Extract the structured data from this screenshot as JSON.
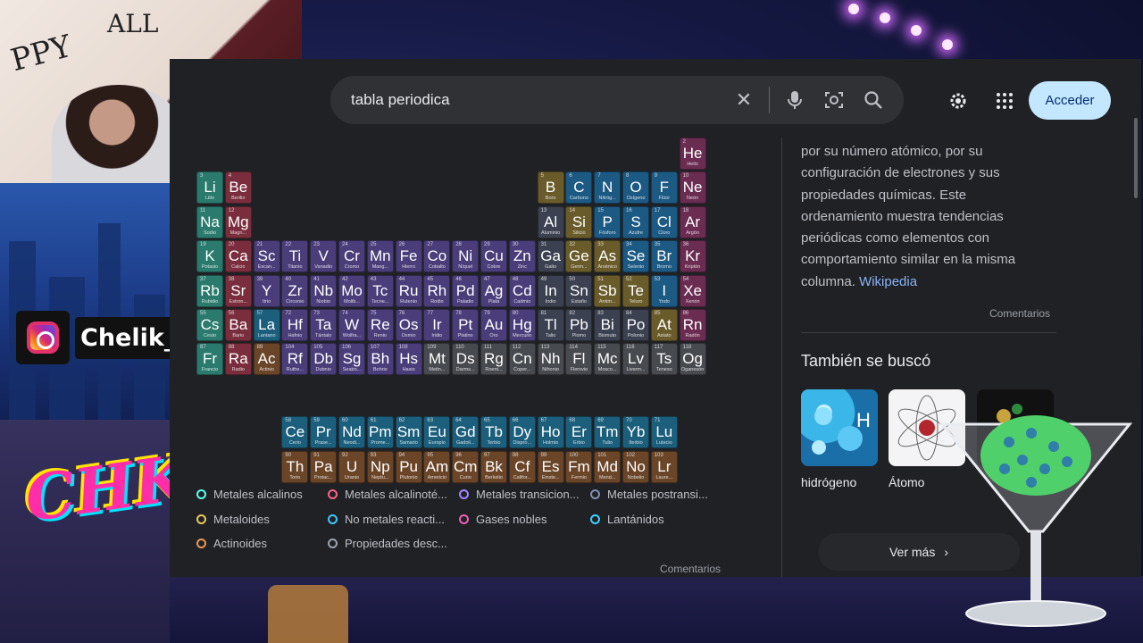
{
  "search": {
    "query": "tabla periodica"
  },
  "header": {
    "login_label": "Acceder"
  },
  "stream": {
    "instagram_handle": "Chelik_Sama",
    "logo_text": "CHK"
  },
  "colors": {
    "alkali": "#2a7a6d",
    "alkaline_earth": "#7a2d3c",
    "transition": "#4a3d7a",
    "post_transition": "#3c4151",
    "metalloid": "#6a5c2a",
    "nonmetal": "#1c5a84",
    "noble_gas": "#6b2c52",
    "lanthanide": "#1b5f7d",
    "actinide": "#6b4528",
    "unknown": "#474a4f"
  },
  "periodic_table": {
    "elements": [
      {
        "n": "2",
        "s": "He",
        "name": "Helio",
        "c": "noble_gas",
        "r": 0,
        "col": 17
      },
      {
        "n": "3",
        "s": "Li",
        "name": "Litio",
        "c": "alkali",
        "r": 1,
        "col": 0
      },
      {
        "n": "4",
        "s": "Be",
        "name": "Berilio",
        "c": "alkaline_earth",
        "r": 1,
        "col": 1
      },
      {
        "n": "5",
        "s": "B",
        "name": "Boro",
        "c": "metalloid",
        "r": 1,
        "col": 12
      },
      {
        "n": "6",
        "s": "C",
        "name": "Carbono",
        "c": "nonmetal",
        "r": 1,
        "col": 13
      },
      {
        "n": "7",
        "s": "N",
        "name": "Nitróg...",
        "c": "nonmetal",
        "r": 1,
        "col": 14
      },
      {
        "n": "8",
        "s": "O",
        "name": "Oxígeno",
        "c": "nonmetal",
        "r": 1,
        "col": 15
      },
      {
        "n": "9",
        "s": "F",
        "name": "Flúor",
        "c": "nonmetal",
        "r": 1,
        "col": 16
      },
      {
        "n": "10",
        "s": "Ne",
        "name": "Neón",
        "c": "noble_gas",
        "r": 1,
        "col": 17
      },
      {
        "n": "11",
        "s": "Na",
        "name": "Sodio",
        "c": "alkali",
        "r": 2,
        "col": 0
      },
      {
        "n": "12",
        "s": "Mg",
        "name": "Magn...",
        "c": "alkaline_earth",
        "r": 2,
        "col": 1
      },
      {
        "n": "13",
        "s": "Al",
        "name": "Aluminio",
        "c": "post_transition",
        "r": 2,
        "col": 12
      },
      {
        "n": "14",
        "s": "Si",
        "name": "Silicio",
        "c": "metalloid",
        "r": 2,
        "col": 13
      },
      {
        "n": "15",
        "s": "P",
        "name": "Fósforo",
        "c": "nonmetal",
        "r": 2,
        "col": 14
      },
      {
        "n": "16",
        "s": "S",
        "name": "Azufre",
        "c": "nonmetal",
        "r": 2,
        "col": 15
      },
      {
        "n": "17",
        "s": "Cl",
        "name": "Cloro",
        "c": "nonmetal",
        "r": 2,
        "col": 16
      },
      {
        "n": "18",
        "s": "Ar",
        "name": "Argón",
        "c": "noble_gas",
        "r": 2,
        "col": 17
      },
      {
        "n": "19",
        "s": "K",
        "name": "Potasio",
        "c": "alkali",
        "r": 3,
        "col": 0
      },
      {
        "n": "20",
        "s": "Ca",
        "name": "Calcio",
        "c": "alkaline_earth",
        "r": 3,
        "col": 1
      },
      {
        "n": "21",
        "s": "Sc",
        "name": "Escan...",
        "c": "transition",
        "r": 3,
        "col": 2
      },
      {
        "n": "22",
        "s": "Ti",
        "name": "Titanio",
        "c": "transition",
        "r": 3,
        "col": 3
      },
      {
        "n": "23",
        "s": "V",
        "name": "Vanadio",
        "c": "transition",
        "r": 3,
        "col": 4
      },
      {
        "n": "24",
        "s": "Cr",
        "name": "Cromo",
        "c": "transition",
        "r": 3,
        "col": 5
      },
      {
        "n": "25",
        "s": "Mn",
        "name": "Mang...",
        "c": "transition",
        "r": 3,
        "col": 6
      },
      {
        "n": "26",
        "s": "Fe",
        "name": "Hierro",
        "c": "transition",
        "r": 3,
        "col": 7
      },
      {
        "n": "27",
        "s": "Co",
        "name": "Cobalto",
        "c": "transition",
        "r": 3,
        "col": 8
      },
      {
        "n": "28",
        "s": "Ni",
        "name": "Níquel",
        "c": "transition",
        "r": 3,
        "col": 9
      },
      {
        "n": "29",
        "s": "Cu",
        "name": "Cobre",
        "c": "transition",
        "r": 3,
        "col": 10
      },
      {
        "n": "30",
        "s": "Zn",
        "name": "Zinc",
        "c": "transition",
        "r": 3,
        "col": 11
      },
      {
        "n": "31",
        "s": "Ga",
        "name": "Galio",
        "c": "post_transition",
        "r": 3,
        "col": 12
      },
      {
        "n": "32",
        "s": "Ge",
        "name": "Germ...",
        "c": "metalloid",
        "r": 3,
        "col": 13
      },
      {
        "n": "33",
        "s": "As",
        "name": "Arsénico",
        "c": "metalloid",
        "r": 3,
        "col": 14
      },
      {
        "n": "34",
        "s": "Se",
        "name": "Selenio",
        "c": "nonmetal",
        "r": 3,
        "col": 15
      },
      {
        "n": "35",
        "s": "Br",
        "name": "Bromo",
        "c": "nonmetal",
        "r": 3,
        "col": 16
      },
      {
        "n": "36",
        "s": "Kr",
        "name": "Kriptón",
        "c": "noble_gas",
        "r": 3,
        "col": 17
      },
      {
        "n": "37",
        "s": "Rb",
        "name": "Rubidio",
        "c": "alkali",
        "r": 4,
        "col": 0
      },
      {
        "n": "38",
        "s": "Sr",
        "name": "Estron...",
        "c": "alkaline_earth",
        "r": 4,
        "col": 1
      },
      {
        "n": "39",
        "s": "Y",
        "name": "Itrio",
        "c": "transition",
        "r": 4,
        "col": 2
      },
      {
        "n": "40",
        "s": "Zr",
        "name": "Circonio",
        "c": "transition",
        "r": 4,
        "col": 3
      },
      {
        "n": "41",
        "s": "Nb",
        "name": "Niobio",
        "c": "transition",
        "r": 4,
        "col": 4
      },
      {
        "n": "42",
        "s": "Mo",
        "name": "Molib...",
        "c": "transition",
        "r": 4,
        "col": 5
      },
      {
        "n": "43",
        "s": "Tc",
        "name": "Tecne...",
        "c": "transition",
        "r": 4,
        "col": 6
      },
      {
        "n": "44",
        "s": "Ru",
        "name": "Rutenio",
        "c": "transition",
        "r": 4,
        "col": 7
      },
      {
        "n": "45",
        "s": "Rh",
        "name": "Rodio",
        "c": "transition",
        "r": 4,
        "col": 8
      },
      {
        "n": "46",
        "s": "Pd",
        "name": "Paladio",
        "c": "transition",
        "r": 4,
        "col": 9
      },
      {
        "n": "47",
        "s": "Ag",
        "name": "Plata",
        "c": "transition",
        "r": 4,
        "col": 10
      },
      {
        "n": "48",
        "s": "Cd",
        "name": "Cadmio",
        "c": "transition",
        "r": 4,
        "col": 11
      },
      {
        "n": "49",
        "s": "In",
        "name": "Indio",
        "c": "post_transition",
        "r": 4,
        "col": 12
      },
      {
        "n": "50",
        "s": "Sn",
        "name": "Estaño",
        "c": "post_transition",
        "r": 4,
        "col": 13
      },
      {
        "n": "51",
        "s": "Sb",
        "name": "Antim...",
        "c": "metalloid",
        "r": 4,
        "col": 14
      },
      {
        "n": "52",
        "s": "Te",
        "name": "Teluro",
        "c": "metalloid",
        "r": 4,
        "col": 15
      },
      {
        "n": "53",
        "s": "I",
        "name": "Yodo",
        "c": "nonmetal",
        "r": 4,
        "col": 16
      },
      {
        "n": "54",
        "s": "Xe",
        "name": "Xenón",
        "c": "noble_gas",
        "r": 4,
        "col": 17
      },
      {
        "n": "55",
        "s": "Cs",
        "name": "Cesio",
        "c": "alkali",
        "r": 5,
        "col": 0
      },
      {
        "n": "56",
        "s": "Ba",
        "name": "Bario",
        "c": "alkaline_earth",
        "r": 5,
        "col": 1
      },
      {
        "n": "57",
        "s": "La",
        "name": "Lantano",
        "c": "lanthanide",
        "r": 5,
        "col": 2
      },
      {
        "n": "72",
        "s": "Hf",
        "name": "Hafnio",
        "c": "transition",
        "r": 5,
        "col": 3
      },
      {
        "n": "73",
        "s": "Ta",
        "name": "Tántalo",
        "c": "transition",
        "r": 5,
        "col": 4
      },
      {
        "n": "74",
        "s": "W",
        "name": "Wolfra...",
        "c": "transition",
        "r": 5,
        "col": 5
      },
      {
        "n": "75",
        "s": "Re",
        "name": "Renio",
        "c": "transition",
        "r": 5,
        "col": 6
      },
      {
        "n": "76",
        "s": "Os",
        "name": "Osmio",
        "c": "transition",
        "r": 5,
        "col": 7
      },
      {
        "n": "77",
        "s": "Ir",
        "name": "Iridio",
        "c": "transition",
        "r": 5,
        "col": 8
      },
      {
        "n": "78",
        "s": "Pt",
        "name": "Platino",
        "c": "transition",
        "r": 5,
        "col": 9
      },
      {
        "n": "79",
        "s": "Au",
        "name": "Oro",
        "c": "transition",
        "r": 5,
        "col": 10
      },
      {
        "n": "80",
        "s": "Hg",
        "name": "Mercurio",
        "c": "transition",
        "r": 5,
        "col": 11
      },
      {
        "n": "81",
        "s": "Tl",
        "name": "Talio",
        "c": "post_transition",
        "r": 5,
        "col": 12
      },
      {
        "n": "82",
        "s": "Pb",
        "name": "Plomo",
        "c": "post_transition",
        "r": 5,
        "col": 13
      },
      {
        "n": "83",
        "s": "Bi",
        "name": "Bismuto",
        "c": "post_transition",
        "r": 5,
        "col": 14
      },
      {
        "n": "84",
        "s": "Po",
        "name": "Polonio",
        "c": "post_transition",
        "r": 5,
        "col": 15
      },
      {
        "n": "85",
        "s": "At",
        "name": "Astato",
        "c": "metalloid",
        "r": 5,
        "col": 16
      },
      {
        "n": "86",
        "s": "Rn",
        "name": "Radón",
        "c": "noble_gas",
        "r": 5,
        "col": 17
      },
      {
        "n": "87",
        "s": "Fr",
        "name": "Francio",
        "c": "alkali",
        "r": 6,
        "col": 0
      },
      {
        "n": "88",
        "s": "Ra",
        "name": "Radio",
        "c": "alkaline_earth",
        "r": 6,
        "col": 1
      },
      {
        "n": "89",
        "s": "Ac",
        "name": "Actinio",
        "c": "actinide",
        "r": 6,
        "col": 2
      },
      {
        "n": "104",
        "s": "Rf",
        "name": "Ruthe...",
        "c": "transition",
        "r": 6,
        "col": 3
      },
      {
        "n": "105",
        "s": "Db",
        "name": "Dubnio",
        "c": "transition",
        "r": 6,
        "col": 4
      },
      {
        "n": "106",
        "s": "Sg",
        "name": "Seabo...",
        "c": "transition",
        "r": 6,
        "col": 5
      },
      {
        "n": "107",
        "s": "Bh",
        "name": "Bohrio",
        "c": "transition",
        "r": 6,
        "col": 6
      },
      {
        "n": "108",
        "s": "Hs",
        "name": "Hasio",
        "c": "transition",
        "r": 6,
        "col": 7
      },
      {
        "n": "109",
        "s": "Mt",
        "name": "Meitn...",
        "c": "unknown",
        "r": 6,
        "col": 8
      },
      {
        "n": "110",
        "s": "Ds",
        "name": "Darms...",
        "c": "unknown",
        "r": 6,
        "col": 9
      },
      {
        "n": "111",
        "s": "Rg",
        "name": "Roent...",
        "c": "unknown",
        "r": 6,
        "col": 10
      },
      {
        "n": "112",
        "s": "Cn",
        "name": "Coper...",
        "c": "unknown",
        "r": 6,
        "col": 11
      },
      {
        "n": "113",
        "s": "Nh",
        "name": "Nihonio",
        "c": "unknown",
        "r": 6,
        "col": 12
      },
      {
        "n": "114",
        "s": "Fl",
        "name": "Flerovio",
        "c": "unknown",
        "r": 6,
        "col": 13
      },
      {
        "n": "115",
        "s": "Mc",
        "name": "Mosco...",
        "c": "unknown",
        "r": 6,
        "col": 14
      },
      {
        "n": "116",
        "s": "Lv",
        "name": "Liverm...",
        "c": "unknown",
        "r": 6,
        "col": 15
      },
      {
        "n": "117",
        "s": "Ts",
        "name": "Teneso",
        "c": "unknown",
        "r": 6,
        "col": 16
      },
      {
        "n": "118",
        "s": "Og",
        "name": "Oganesón",
        "c": "unknown",
        "r": 6,
        "col": 17
      },
      {
        "n": "58",
        "s": "Ce",
        "name": "Cerio",
        "c": "lanthanide",
        "r": 8,
        "col": 3
      },
      {
        "n": "59",
        "s": "Pr",
        "name": "Prase...",
        "c": "lanthanide",
        "r": 8,
        "col": 4
      },
      {
        "n": "60",
        "s": "Nd",
        "name": "Neodi...",
        "c": "lanthanide",
        "r": 8,
        "col": 5
      },
      {
        "n": "61",
        "s": "Pm",
        "name": "Prome...",
        "c": "lanthanide",
        "r": 8,
        "col": 6
      },
      {
        "n": "62",
        "s": "Sm",
        "name": "Samario",
        "c": "lanthanide",
        "r": 8,
        "col": 7
      },
      {
        "n": "63",
        "s": "Eu",
        "name": "Europio",
        "c": "lanthanide",
        "r": 8,
        "col": 8
      },
      {
        "n": "64",
        "s": "Gd",
        "name": "Gadoli...",
        "c": "lanthanide",
        "r": 8,
        "col": 9
      },
      {
        "n": "65",
        "s": "Tb",
        "name": "Terbio",
        "c": "lanthanide",
        "r": 8,
        "col": 10
      },
      {
        "n": "66",
        "s": "Dy",
        "name": "Dispro...",
        "c": "lanthanide",
        "r": 8,
        "col": 11
      },
      {
        "n": "67",
        "s": "Ho",
        "name": "Holmio",
        "c": "lanthanide",
        "r": 8,
        "col": 12
      },
      {
        "n": "68",
        "s": "Er",
        "name": "Erbio",
        "c": "lanthanide",
        "r": 8,
        "col": 13
      },
      {
        "n": "69",
        "s": "Tm",
        "name": "Tulio",
        "c": "lanthanide",
        "r": 8,
        "col": 14
      },
      {
        "n": "70",
        "s": "Yb",
        "name": "Iterbio",
        "c": "lanthanide",
        "r": 8,
        "col": 15
      },
      {
        "n": "71",
        "s": "Lu",
        "name": "Lutecio",
        "c": "lanthanide",
        "r": 8,
        "col": 16
      },
      {
        "n": "90",
        "s": "Th",
        "name": "Torio",
        "c": "actinide",
        "r": 9,
        "col": 3
      },
      {
        "n": "91",
        "s": "Pa",
        "name": "Protac...",
        "c": "actinide",
        "r": 9,
        "col": 4
      },
      {
        "n": "92",
        "s": "U",
        "name": "Uranio",
        "c": "actinide",
        "r": 9,
        "col": 5
      },
      {
        "n": "93",
        "s": "Np",
        "name": "Neptu...",
        "c": "actinide",
        "r": 9,
        "col": 6
      },
      {
        "n": "94",
        "s": "Pu",
        "name": "Plutonio",
        "c": "actinide",
        "r": 9,
        "col": 7
      },
      {
        "n": "95",
        "s": "Am",
        "name": "Americio",
        "c": "actinide",
        "r": 9,
        "col": 8
      },
      {
        "n": "96",
        "s": "Cm",
        "name": "Curio",
        "c": "actinide",
        "r": 9,
        "col": 9
      },
      {
        "n": "97",
        "s": "Bk",
        "name": "Berkelio",
        "c": "actinide",
        "r": 9,
        "col": 10
      },
      {
        "n": "98",
        "s": "Cf",
        "name": "Califor...",
        "c": "actinide",
        "r": 9,
        "col": 11
      },
      {
        "n": "99",
        "s": "Es",
        "name": "Einste...",
        "c": "actinide",
        "r": 9,
        "col": 12
      },
      {
        "n": "100",
        "s": "Fm",
        "name": "Fermio",
        "c": "actinide",
        "r": 9,
        "col": 13
      },
      {
        "n": "101",
        "s": "Md",
        "name": "Mend...",
        "c": "actinide",
        "r": 9,
        "col": 14
      },
      {
        "n": "102",
        "s": "No",
        "name": "Nobelio",
        "c": "actinide",
        "r": 9,
        "col": 15
      },
      {
        "n": "103",
        "s": "Lr",
        "name": "Laure...",
        "c": "actinide",
        "r": 9,
        "col": 16
      }
    ],
    "legend": [
      {
        "label": "Metales alcalinos",
        "c": "alkali"
      },
      {
        "label": "Metales alcalinoté...",
        "c": "alkaline_earth"
      },
      {
        "label": "Metales transicion...",
        "c": "transition"
      },
      {
        "label": "Metales postransi...",
        "c": "post_transition"
      },
      {
        "label": "Metaloides",
        "c": "metalloid"
      },
      {
        "label": "No metales reacti...",
        "c": "nonmetal"
      },
      {
        "label": "Gases nobles",
        "c": "noble_gas"
      },
      {
        "label": "Lantánidos",
        "c": "lanthanide"
      },
      {
        "label": "Actinoides",
        "c": "actinide"
      },
      {
        "label": "Propiedades desc...",
        "c": "unknown"
      }
    ],
    "comments_label": "Comentarios"
  },
  "knowledge_panel": {
    "desc_lines": [
      "por su número atómico,  por su",
      "configuración de electrones y sus",
      "propiedades químicas. Este",
      "ordenamiento muestra tendencias",
      "periódicas como elementos con",
      "comportamiento similar en la misma",
      "columna."
    ],
    "source_link": "Wikipedia",
    "comments_label": "Comentarios",
    "also_searched_title": "También se buscó",
    "also_searched": [
      {
        "label": "hidrógeno",
        "icon": "hydrogen-image"
      },
      {
        "label": "Átomo",
        "icon": "atom-image"
      },
      {
        "label": "",
        "icon": "third-result-image"
      }
    ],
    "more_label": "Ver más"
  }
}
